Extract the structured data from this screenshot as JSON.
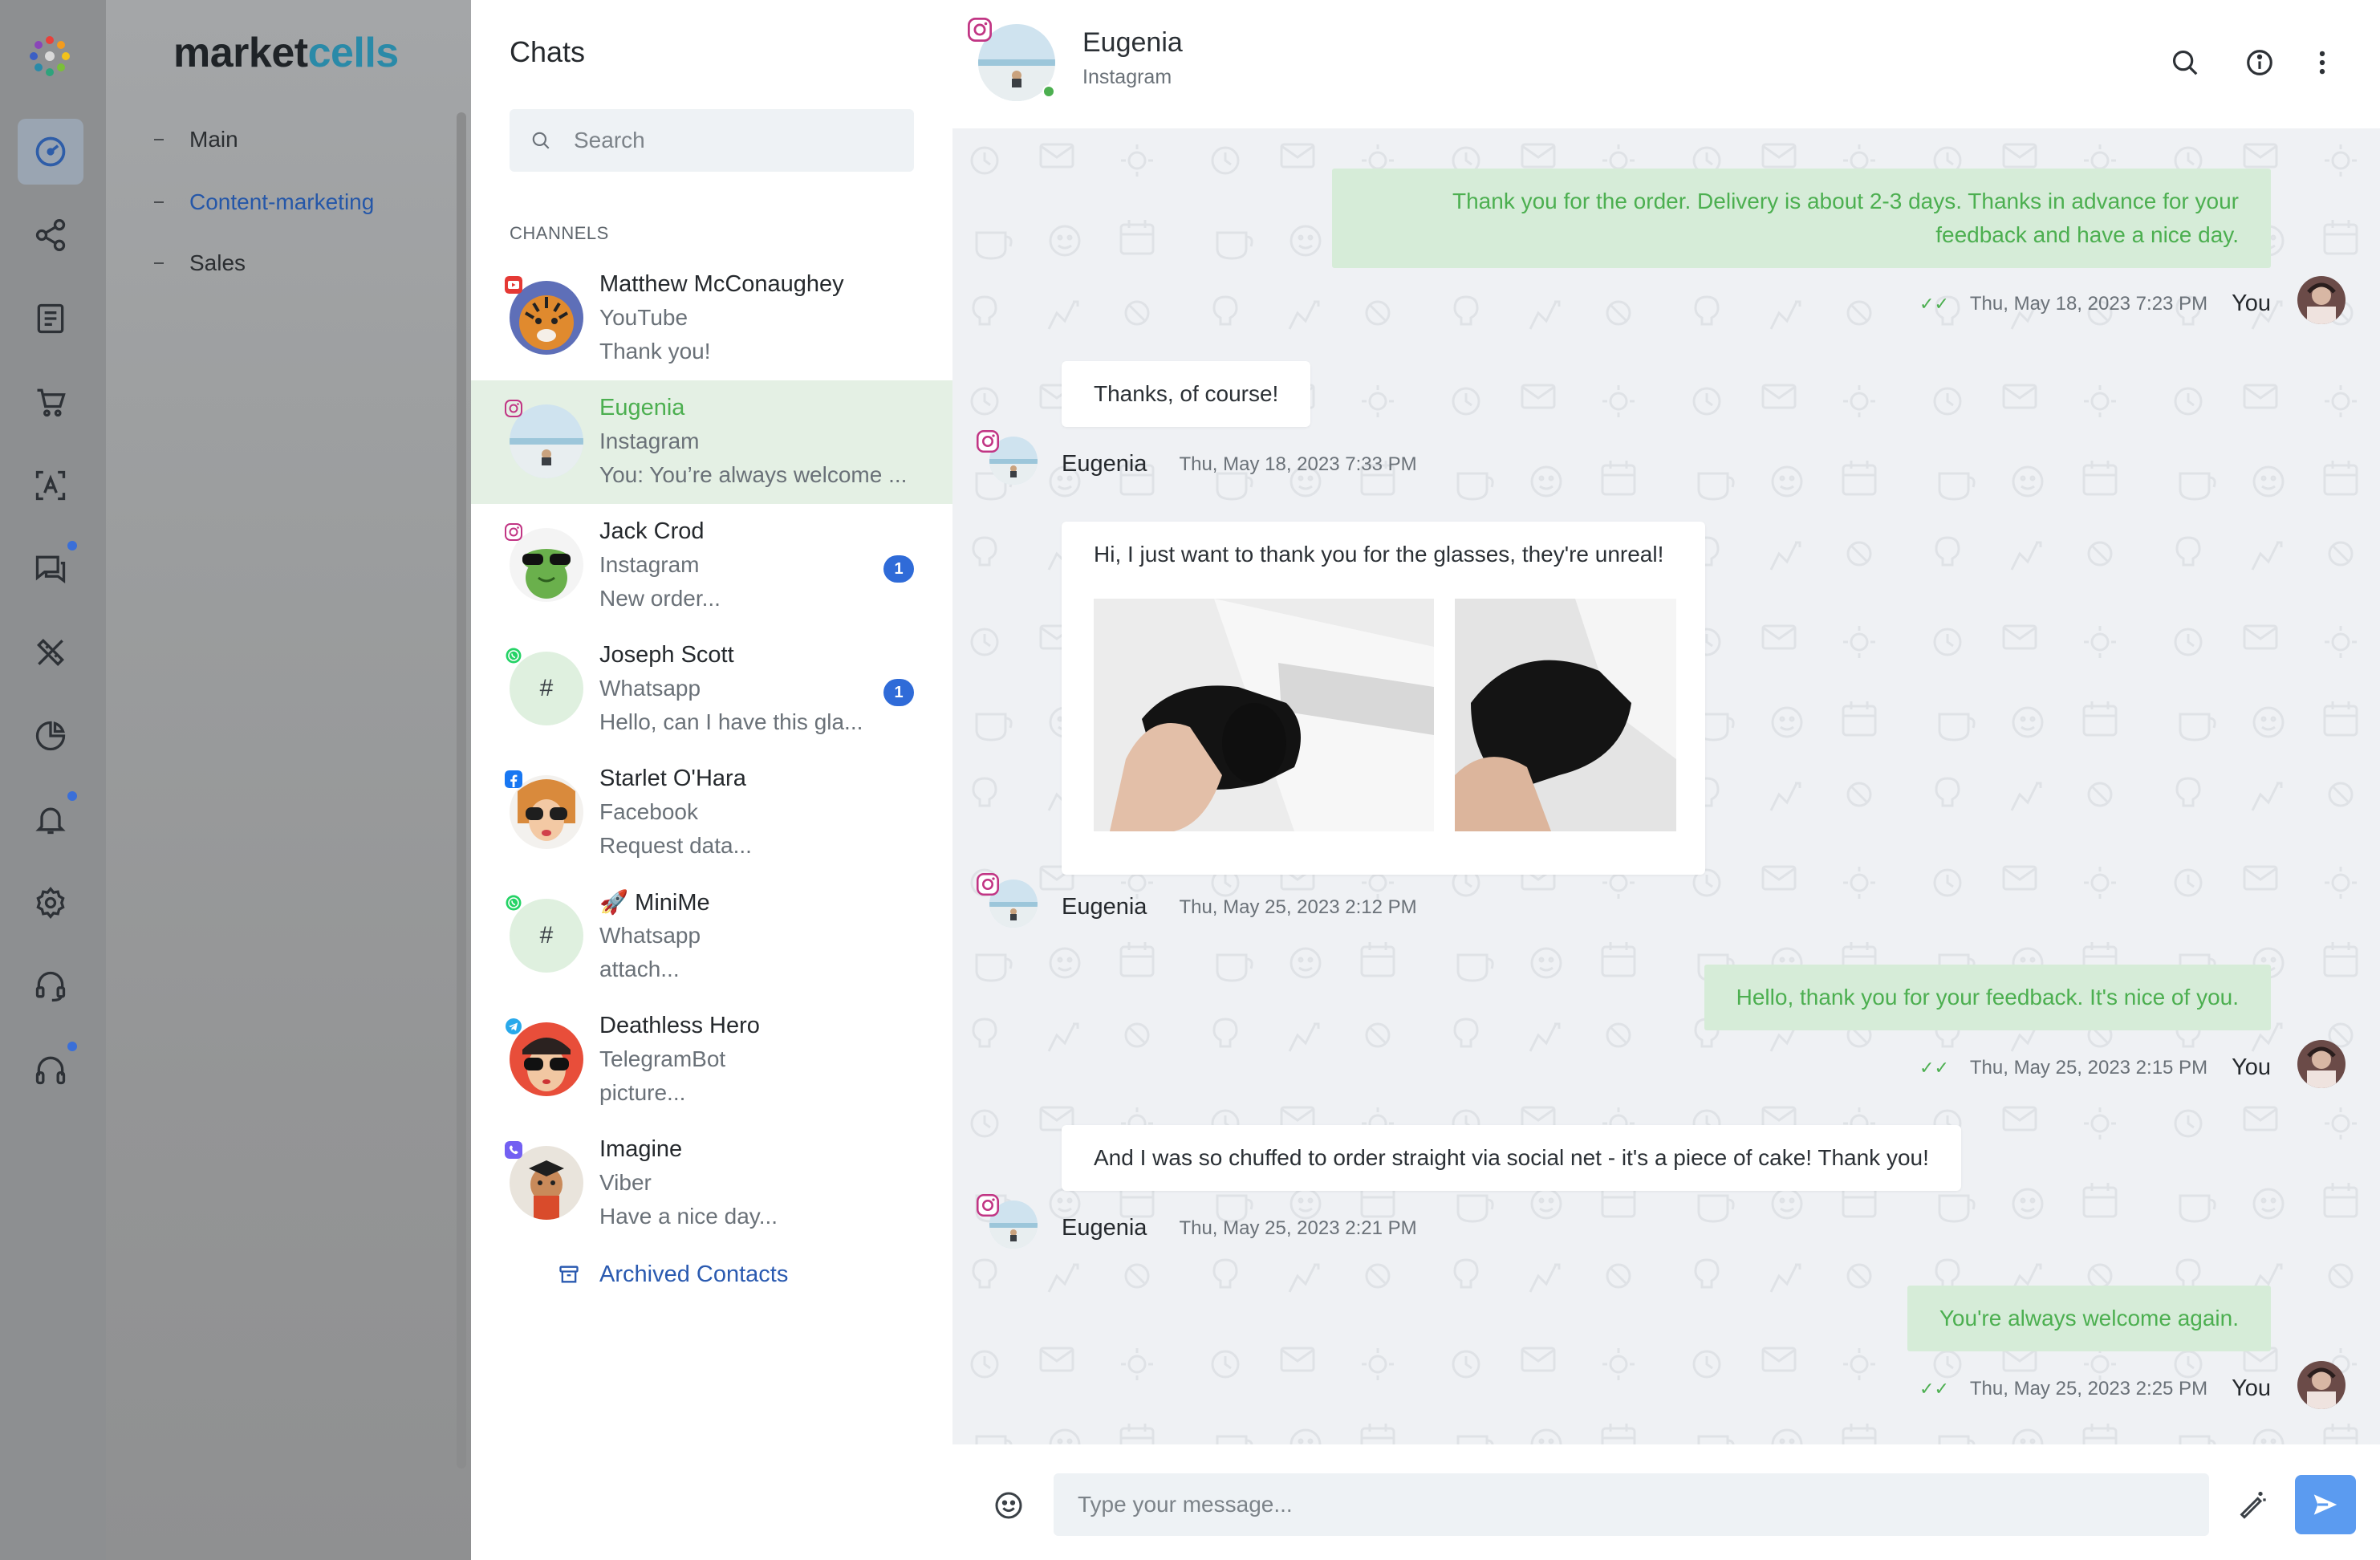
{
  "brand": {
    "part1": "market",
    "part2": "cells"
  },
  "nav": {
    "items": [
      {
        "label": "Main",
        "active": false
      },
      {
        "label": "Content-marketing",
        "active": true
      },
      {
        "label": "Sales",
        "active": false
      }
    ]
  },
  "rail": {
    "items": [
      {
        "icon": "dashboard-icon",
        "active": true,
        "dot": false
      },
      {
        "icon": "share-icon",
        "active": false,
        "dot": false
      },
      {
        "icon": "document-icon",
        "active": false,
        "dot": false
      },
      {
        "icon": "cart-icon",
        "active": false,
        "dot": false
      },
      {
        "icon": "translate-icon",
        "active": false,
        "dot": false
      },
      {
        "icon": "chat-icon",
        "active": false,
        "dot": true
      },
      {
        "icon": "design-tools-icon",
        "active": false,
        "dot": false
      },
      {
        "icon": "pie-chart-icon",
        "active": false,
        "dot": false
      },
      {
        "icon": "bell-icon",
        "active": false,
        "dot": true
      },
      {
        "icon": "gear-icon",
        "active": false,
        "dot": false
      },
      {
        "icon": "support-icon",
        "active": false,
        "dot": false
      },
      {
        "icon": "headphones-icon",
        "active": false,
        "dot": true
      }
    ]
  },
  "chats": {
    "title": "Chats",
    "search_placeholder": "Search",
    "channels_label": "CHANNELS",
    "list": [
      {
        "name": "Matthew McConaughey",
        "channel": "YouTube",
        "preview": "Thank you!",
        "source": "youtube",
        "unread": ""
      },
      {
        "name": "Eugenia",
        "channel": "Instagram",
        "preview": "You: You’re always welcome ...",
        "source": "instagram",
        "unread": ""
      },
      {
        "name": "Jack Crod",
        "channel": "Instagram",
        "preview": "New order...",
        "source": "instagram",
        "unread": "1"
      },
      {
        "name": "Joseph Scott",
        "channel": "Whatsapp",
        "preview": "Hello, can I have this gla...",
        "source": "whatsapp",
        "unread": "1",
        "avatar_text": "#"
      },
      {
        "name": "Starlet O'Hara",
        "channel": "Facebook",
        "preview": "Request data...",
        "source": "facebook",
        "unread": ""
      },
      {
        "name": "🚀 MiniMe",
        "channel": "Whatsapp",
        "preview": "attach...",
        "source": "whatsapp",
        "unread": "",
        "avatar_text": "#"
      },
      {
        "name": "Deathless Hero",
        "channel": "TelegramBot",
        "preview": "picture...",
        "source": "telegram",
        "unread": ""
      },
      {
        "name": "Imagine",
        "channel": "Viber",
        "preview": "Have a nice day...",
        "source": "viber",
        "unread": ""
      }
    ],
    "archived_label": "Archived Contacts"
  },
  "conversation": {
    "contact_name": "Eugenia",
    "contact_channel": "Instagram",
    "messages": [
      {
        "direction": "out",
        "text_line1": "Thank you for the order. Delivery is about 2-3 days. Thanks in advance for your",
        "text_line2": "feedback and have a nice day.",
        "time": "Thu, May 18, 2023 7:23 PM",
        "author": "You"
      },
      {
        "direction": "in",
        "text": "Thanks, of course!",
        "time": "Thu, May 18, 2023 7:33 PM",
        "author": "Eugenia"
      },
      {
        "direction": "in",
        "text": "Hi, I just want to thank you for the glasses, they're unreal!",
        "time": "Thu, May 25, 2023 2:12 PM",
        "author": "Eugenia"
      },
      {
        "direction": "out",
        "text": "Hello, thank you for your feedback. It's nice of you.",
        "time": "Thu, May 25, 2023 2:15 PM",
        "author": "You"
      },
      {
        "direction": "in",
        "text": "And I was so chuffed to order straight via social net - it's a piece of cake! Thank you!",
        "time": "Thu, May 25, 2023 2:21 PM",
        "author": "Eugenia"
      },
      {
        "direction": "out",
        "text": "You're always welcome again.",
        "time": "Thu, May 25, 2023 2:25 PM",
        "author": "You"
      }
    ]
  },
  "composer": {
    "placeholder": "Type your message..."
  },
  "colors": {
    "accent": "#4caf50",
    "brand_teal": "#2a8aa8",
    "link": "#2a5ab0",
    "send": "#5b9bf0",
    "unread": "#2f6bd8"
  }
}
